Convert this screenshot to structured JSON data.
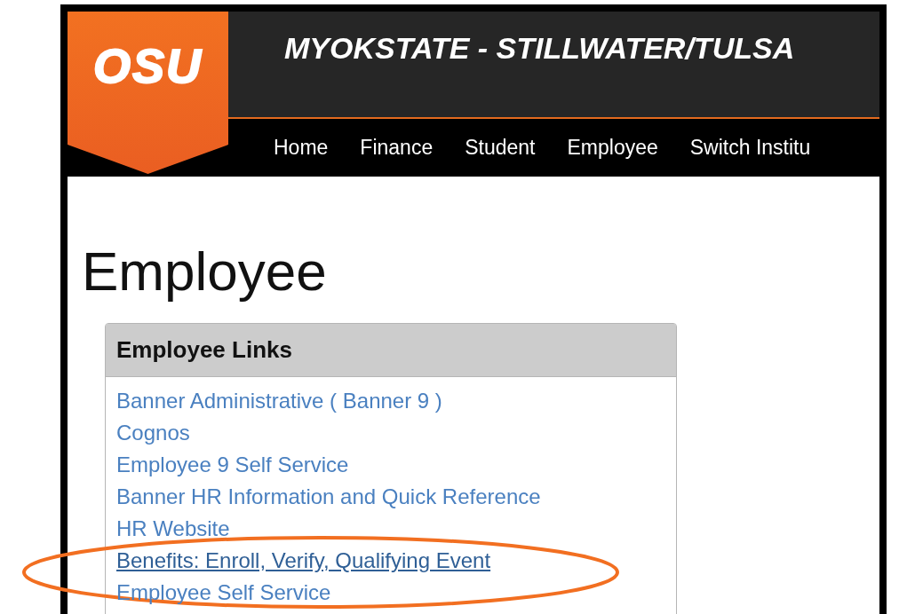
{
  "logo": {
    "text": "OSU"
  },
  "site_title": "MYOKSTATE - STILLWATER/TULSA",
  "nav": [
    {
      "label": "Home"
    },
    {
      "label": "Finance"
    },
    {
      "label": "Student"
    },
    {
      "label": "Employee"
    },
    {
      "label": "Switch Institu"
    }
  ],
  "page_title": "Employee",
  "panel": {
    "title": "Employee Links",
    "links": [
      {
        "label": "Banner Administrative ( Banner 9 )",
        "hovered": false
      },
      {
        "label": "Cognos",
        "hovered": false
      },
      {
        "label": "Employee 9 Self Service",
        "hovered": false
      },
      {
        "label": "Banner HR Information and Quick Reference",
        "hovered": false
      },
      {
        "label": "HR Website",
        "hovered": false
      },
      {
        "label": "Benefits: Enroll, Verify, Qualifying Event",
        "hovered": true
      },
      {
        "label": "Employee Self Service",
        "hovered": false
      }
    ]
  },
  "annotation": {
    "kind": "ellipse"
  }
}
